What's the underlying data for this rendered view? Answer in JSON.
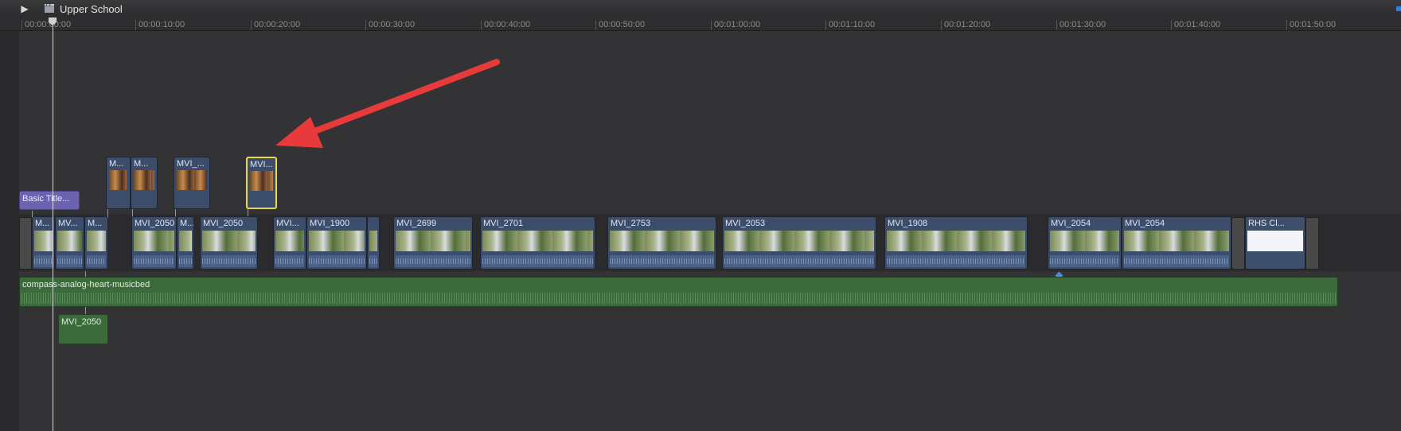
{
  "project": {
    "name": "Upper School"
  },
  "ruler": {
    "ticks": [
      "00:00:00:00",
      "00:00:10:00",
      "00:00:20:00",
      "00:00:30:00",
      "00:00:40:00",
      "00:00:50:00",
      "00:01:00:00",
      "00:01:10:00",
      "00:01:20:00",
      "00:01:30:00",
      "00:01:40:00",
      "00:01:50:00"
    ]
  },
  "connected_clips": [
    {
      "label": "M..."
    },
    {
      "label": "M..."
    },
    {
      "label": "MVI_..."
    },
    {
      "label": "MVI..."
    }
  ],
  "title_clip": {
    "label": "Basic Title..."
  },
  "primary_storyline": [
    {
      "label": "M..."
    },
    {
      "label": "MV..."
    },
    {
      "label": "M..."
    },
    {
      "label": "MVI_2050"
    },
    {
      "label": "M..."
    },
    {
      "label": "MVI_2050"
    },
    {
      "label": "MVI..."
    },
    {
      "label": "MVI_1900"
    },
    {
      "label": ""
    },
    {
      "label": "MVI_2699"
    },
    {
      "label": "MVI_2701"
    },
    {
      "label": "MVI_2753"
    },
    {
      "label": "MVI_2053"
    },
    {
      "label": "MVI_1908"
    },
    {
      "label": "MVI_2054"
    },
    {
      "label": "MVI_2054"
    },
    {
      "label": "RHS Cl..."
    }
  ],
  "music": {
    "label": "compass-analog-heart-musicbed"
  },
  "audio_clip": {
    "label": "MVI_2050"
  },
  "colors": {
    "video_clip": "#3b4d6b",
    "audio": "#3b6a3b",
    "title": "#6c63b0",
    "selected": "#e8d84a",
    "arrow": "#e83a3a"
  }
}
